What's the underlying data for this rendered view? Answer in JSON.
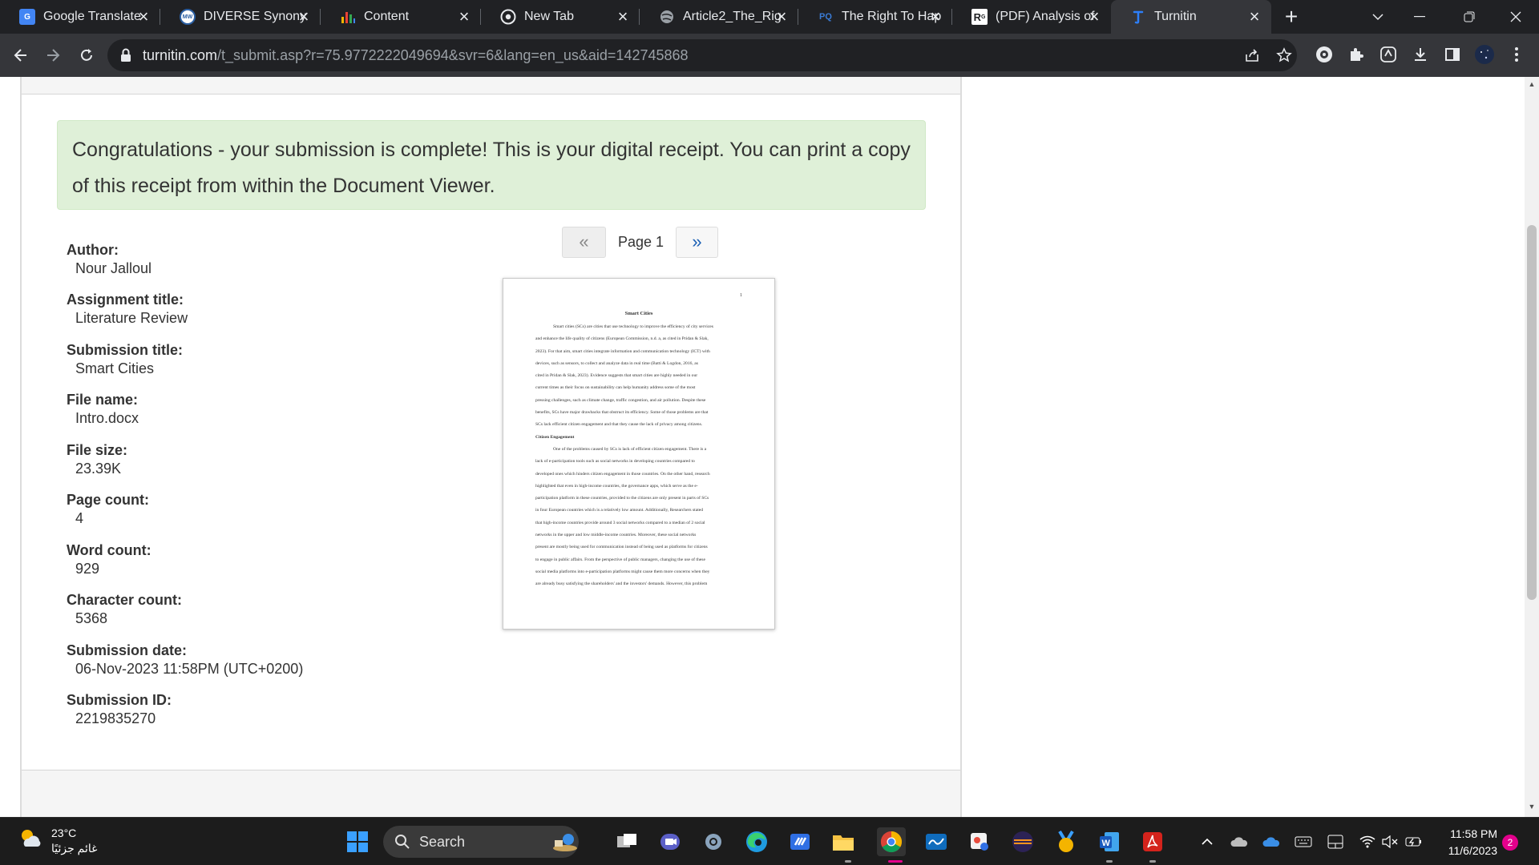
{
  "tabs": [
    {
      "title": "Google Translate",
      "icon": "google-translate-icon",
      "color": "#4285f4"
    },
    {
      "title": "DIVERSE Synonym",
      "icon": "merriam-webster-icon",
      "color": "#2b5fa3"
    },
    {
      "title": "Content",
      "icon": "bar-chart-icon",
      "color": "#f4b400"
    },
    {
      "title": "New Tab",
      "icon": "chrome-icon",
      "color": "#e8eaed"
    },
    {
      "title": "Article2_The_Rig",
      "icon": "globe-icon",
      "color": "#9aa0a6"
    },
    {
      "title": "The Right To Hap",
      "icon": "proquest-icon",
      "color": "#3a7bd5"
    },
    {
      "title": "(PDF) Analysis of",
      "icon": "researchgate-icon",
      "color": "#ffffff"
    },
    {
      "title": "Turnitin",
      "icon": "turnitin-icon",
      "color": "#2d7ff9"
    }
  ],
  "browser": {
    "url_host": "turnitin.com",
    "url_path": "/t_submit.asp?r=75.9772222049694&svr=6&lang=en_us&aid=142745868"
  },
  "page": {
    "alert_text": "Congratulations - your submission is complete! This is your digital receipt. You can print a copy of this receipt from within the Document Viewer.",
    "fields": [
      {
        "label": "Author:",
        "value": "Nour Jalloul"
      },
      {
        "label": "Assignment title:",
        "value": "Literature Review"
      },
      {
        "label": "Submission title:",
        "value": "Smart Cities"
      },
      {
        "label": "File name:",
        "value": "Intro.docx"
      },
      {
        "label": "File size:",
        "value": "23.39K"
      },
      {
        "label": "Page count:",
        "value": "4"
      },
      {
        "label": "Word count:",
        "value": "929"
      },
      {
        "label": "Character count:",
        "value": "5368"
      },
      {
        "label": "Submission date:",
        "value": "06-Nov-2023 11:58PM (UTC+0200)"
      },
      {
        "label": "Submission ID:",
        "value": "2219835270"
      }
    ],
    "pager": {
      "prev": "«",
      "label": "Page 1",
      "next": "»"
    },
    "document": {
      "page_number": "1",
      "title": "Smart Cities",
      "lines": [
        {
          "text": "Smart cities (SCs) are cities that use technology to improve the efficiency of city services",
          "style": "indent"
        },
        {
          "text": "and enhance the life quality of citizens (European Commission, n.d. a, as cited in Pridan & Slak,",
          "style": ""
        },
        {
          "text": "2023). For that aim, smart cities integrate information and communication technology (ICT) with",
          "style": ""
        },
        {
          "text": "devices, such as sensors, to collect and analyze data in real time (Batti & Logdon, 2016, as",
          "style": ""
        },
        {
          "text": "cited in Pridan & Slak, 2023). Evidence suggests that smart cities are highly needed in our",
          "style": ""
        },
        {
          "text": "current times as their focus on sustainability can help humanity address some of the most",
          "style": ""
        },
        {
          "text": "pressing challenges, such as climate change, traffic congestion, and air pollution. Despite these",
          "style": ""
        },
        {
          "text": "benefits, SCs have major drawbacks that obstruct its efficiency. Some of those problems are that",
          "style": ""
        },
        {
          "text": "SCs lack efficient citizen engagement and that they cause the lack of privacy among citizens.",
          "style": ""
        },
        {
          "text": "Citizen Engagement",
          "style": "head"
        },
        {
          "text": "One of the problems caused by SCs is lack of efficient citizen engagement. There is a",
          "style": "indent"
        },
        {
          "text": "lack of e-participation tools such as social networks in developing countries compared to",
          "style": ""
        },
        {
          "text": "developed ones which hinders citizen engagement in those countries. On the other hand, research",
          "style": ""
        },
        {
          "text": "highlighted that even in high-income countries, the governance apps, which serve as the e-",
          "style": ""
        },
        {
          "text": "participation platform in these countries, provided to the citizens are only present in parts of SCs",
          "style": ""
        },
        {
          "text": "in four European countries which is a relatively low amount. Additionally, Researchers stated",
          "style": ""
        },
        {
          "text": "that high-income countries provide around 3 social networks compared to a median of 2 social",
          "style": ""
        },
        {
          "text": "networks in the upper and low middle-income countries. Moreover, these social networks",
          "style": ""
        },
        {
          "text": "present are mostly being used for communication instead of being used as platforms for citizens",
          "style": ""
        },
        {
          "text": "to engage in public affairs. From the perspective of public managers, changing the use of these",
          "style": ""
        },
        {
          "text": "social media platforms into e-participation platforms might cause them more concerns when they",
          "style": ""
        },
        {
          "text": "are already busy satisfying the shareholders' and the investors' demands. However, this problem",
          "style": ""
        }
      ]
    }
  },
  "taskbar": {
    "weather_temp": "23°C",
    "weather_desc": "غائم جزئيًا",
    "search_label": "Search",
    "time": "11:58 PM",
    "date": "11/6/2023",
    "notification_count": "2"
  },
  "colors": {
    "alert_bg": "#dff0d8",
    "chrome_dark": "#202124",
    "chrome_toolbar": "#35363a",
    "accent_blue": "#1a5fb4"
  }
}
